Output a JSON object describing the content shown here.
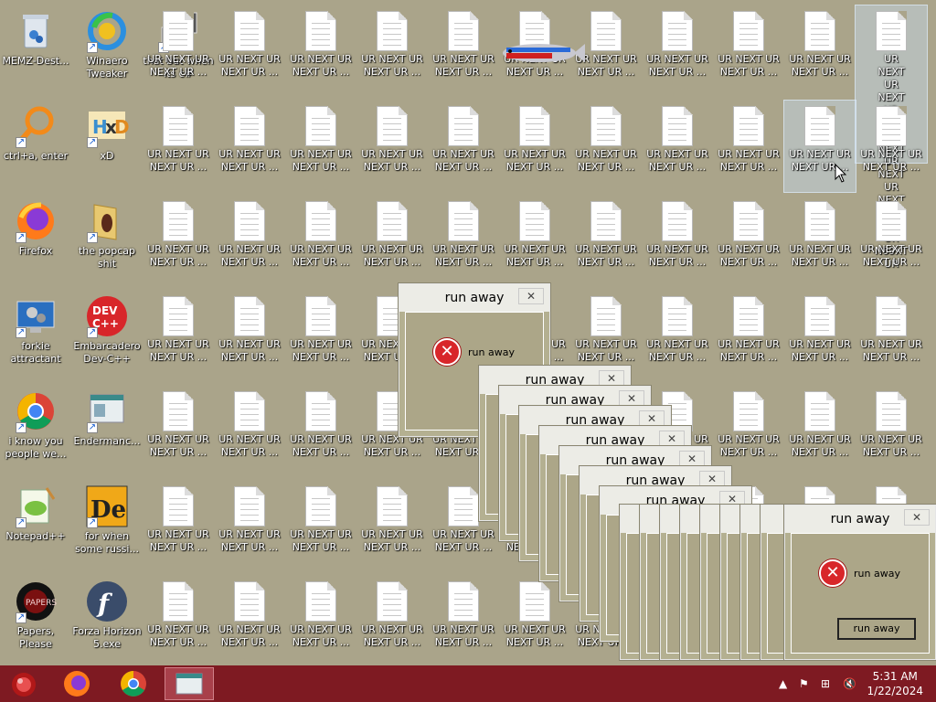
{
  "desktop": {
    "left_icons": [
      {
        "label": "MEMZ-Dest...",
        "icon": "recycle-bin-icon"
      },
      {
        "label": "Winaero Tweaker",
        "icon": "winaero-icon"
      },
      {
        "label": "that but when its c#",
        "icon": "stack-icon"
      },
      {
        "label": "ctrl+a, enter",
        "icon": "magnifier-icon"
      },
      {
        "label": "xD",
        "icon": "hxd-icon"
      },
      {
        "label": "Firefox",
        "icon": "firefox-icon"
      },
      {
        "label": "the popcap shit",
        "icon": "folder-icon"
      },
      {
        "label": "forkie attractant",
        "icon": "monitor-gear-icon"
      },
      {
        "label": "Embarcadero Dev-C++",
        "icon": "devcpp-icon"
      },
      {
        "label": "i know you people we...",
        "icon": "chrome-icon"
      },
      {
        "label": "Endermanc...",
        "icon": "window-icon"
      },
      {
        "label": "Notepad++",
        "icon": "notepadpp-icon"
      },
      {
        "label": "for when some russi...",
        "icon": "de-icon"
      },
      {
        "label": "Papers, Please",
        "icon": "papers-icon"
      },
      {
        "label": "Forza Horizon 5.exe",
        "icon": "flash-icon"
      }
    ],
    "file_label_short": "UR NEXT UR NEXT UR ...",
    "file_label_expanded": "UR NEXT UR NEXT UR NEXT UR NEXT UR NEXT UR NEXT UR NEXT UR N69XT UR"
  },
  "dialog": {
    "title": "run away",
    "message": "run away",
    "button": "run away",
    "close": "✕"
  },
  "taskbar": {
    "time": "5:31 AM",
    "date": "1/22/2024"
  },
  "colors": {
    "desktop_bg": "#aaa48a",
    "taskbar_bg": "#7e1a22",
    "error_red": "#d8262a"
  }
}
